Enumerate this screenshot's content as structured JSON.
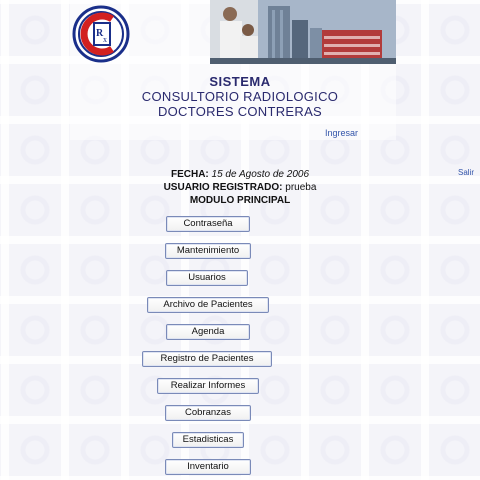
{
  "header": {
    "title_main": "SISTEMA",
    "title_line1": "CONSULTORIO RADIOLOGICO",
    "title_line2": "DOCTORES CONTRERAS",
    "login_link": "Ingresar",
    "logout_link": "Salir"
  },
  "session": {
    "date_label": "FECHA:",
    "date_value": "15 de Agosto de 2006",
    "user_label": "USUARIO REGISTRADO:",
    "user_value": "prueba",
    "module": "MODULO PRINCIPAL"
  },
  "menu": [
    {
      "label": "Contraseña"
    },
    {
      "label": "Mantenimiento"
    },
    {
      "label": "Usuarios"
    },
    {
      "label": "Archivo de Pacientes"
    },
    {
      "label": "Agenda"
    },
    {
      "label": "Registro de Pacientes"
    },
    {
      "label": "Realizar Informes"
    },
    {
      "label": "Cobranzas"
    },
    {
      "label": "Estadisticas"
    },
    {
      "label": "Inventario"
    }
  ],
  "colors": {
    "title": "#2a2a6e",
    "link": "#3355aa",
    "logo_red": "#d22020",
    "logo_blue": "#1a2f8a"
  }
}
